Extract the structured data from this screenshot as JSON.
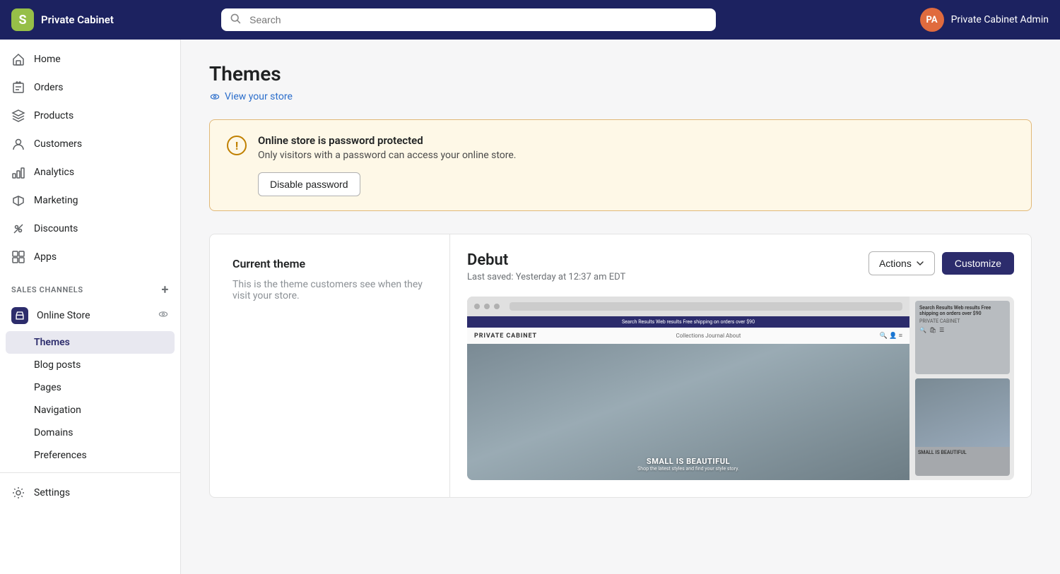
{
  "app": {
    "brand": "Private Cabinet",
    "avatar_initials": "PA",
    "admin_name": "Private Cabinet Admin"
  },
  "search": {
    "placeholder": "Search"
  },
  "sidebar": {
    "nav_items": [
      {
        "id": "home",
        "label": "Home",
        "icon": "home"
      },
      {
        "id": "orders",
        "label": "Orders",
        "icon": "orders"
      },
      {
        "id": "products",
        "label": "Products",
        "icon": "products"
      },
      {
        "id": "customers",
        "label": "Customers",
        "icon": "customers"
      },
      {
        "id": "analytics",
        "label": "Analytics",
        "icon": "analytics"
      },
      {
        "id": "marketing",
        "label": "Marketing",
        "icon": "marketing"
      },
      {
        "id": "discounts",
        "label": "Discounts",
        "icon": "discounts"
      },
      {
        "id": "apps",
        "label": "Apps",
        "icon": "apps"
      }
    ],
    "sales_channels_label": "SALES CHANNELS",
    "online_store_label": "Online Store",
    "sub_items": [
      {
        "id": "themes",
        "label": "Themes",
        "active": true
      },
      {
        "id": "blog-posts",
        "label": "Blog posts"
      },
      {
        "id": "pages",
        "label": "Pages"
      },
      {
        "id": "navigation",
        "label": "Navigation"
      },
      {
        "id": "domains",
        "label": "Domains"
      },
      {
        "id": "preferences",
        "label": "Preferences"
      }
    ],
    "settings_label": "Settings"
  },
  "page": {
    "title": "Themes",
    "view_store_link": "View your store"
  },
  "password_banner": {
    "title": "Online store is password protected",
    "description": "Only visitors with a password can access your online store.",
    "disable_btn": "Disable password"
  },
  "current_theme": {
    "section_title": "Current theme",
    "section_desc": "This is the theme customers see when they visit your store.",
    "theme_name": "Debut",
    "last_saved": "Last saved: Yesterday at 12:37 am EDT",
    "actions_btn": "Actions",
    "customize_btn": "Customize",
    "screenshot": {
      "store_name": "PRIVATE CABINET",
      "nav_items": "Collections  Journal  About",
      "hero_title": "SMALL IS BEAUTIFUL",
      "card_title": "Search Results Web results Free shipping on orders over $90",
      "card_store": "PRIVATE CABINET",
      "lower_title": "SMALL IS BEAUTIFUL"
    }
  }
}
